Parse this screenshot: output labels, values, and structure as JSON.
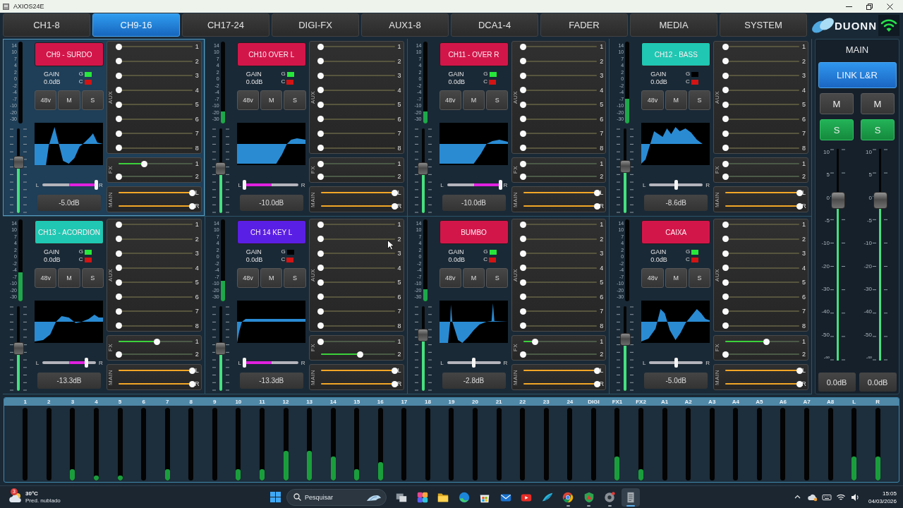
{
  "window": {
    "title": "AXIOS24E"
  },
  "tabs": [
    {
      "label": "CH1-8",
      "selected": false
    },
    {
      "label": "CH9-16",
      "selected": true
    },
    {
      "label": "CH17-24",
      "selected": false
    },
    {
      "label": "DIGI-FX",
      "selected": false
    },
    {
      "label": "AUX1-8",
      "selected": false
    },
    {
      "label": "DCA1-4",
      "selected": false
    },
    {
      "label": "FADER",
      "selected": false
    },
    {
      "label": "MEDIA",
      "selected": false
    },
    {
      "label": "SYSTEM",
      "selected": false
    }
  ],
  "logo": {
    "text": "DUONN"
  },
  "channels": [
    {
      "name": "CH9 - SURDO",
      "color": "#d3164a",
      "selected": true,
      "meter_scale": [
        "14",
        "10",
        "7",
        "4",
        "2",
        "0",
        "-2",
        "-4",
        "-7",
        "-10",
        "-20",
        "-30"
      ],
      "fader": {
        "level": 0.62
      },
      "gain": {
        "label": "GAIN",
        "value": "0.0dB"
      },
      "indicators": [
        {
          "label": "G",
          "color": "#27e83a",
          "on": true
        },
        {
          "label": "C",
          "color": "#d21414",
          "on": true
        }
      ],
      "buttons": [
        {
          "label": "48v",
          "on": false
        },
        {
          "label": "M",
          "on": false
        },
        {
          "label": "S",
          "on": false
        }
      ],
      "pan": {
        "left": "L",
        "right": "R",
        "level": 1
      },
      "fader_value": "-5.0dB",
      "aux": {
        "title": "AUX",
        "sends": [
          {
            "label": "1",
            "level": 0
          },
          {
            "label": "2",
            "level": 0
          },
          {
            "label": "3",
            "level": 0
          },
          {
            "label": "4",
            "level": 0
          },
          {
            "label": "5",
            "level": 0
          },
          {
            "label": "6",
            "level": 0
          },
          {
            "label": "7",
            "level": 0
          },
          {
            "label": "8",
            "level": 0
          }
        ]
      },
      "fx": {
        "title": "FX",
        "sends": [
          {
            "label": "1",
            "level": 0.35
          },
          {
            "label": "2",
            "level": 0
          }
        ]
      },
      "main": {
        "title": "MAIN",
        "sends": [
          {
            "label": "L",
            "level": 1
          },
          {
            "label": "R",
            "level": 1
          }
        ]
      }
    },
    {
      "name": "CH10 OVER L",
      "color": "#d3164a",
      "selected": false,
      "meter_scale": [
        "14",
        "10",
        "7",
        "4",
        "2",
        "0",
        "-2",
        "-4",
        "-7",
        "-10",
        "-20",
        "-30"
      ],
      "meter": {
        "level": 0.15
      },
      "fader": {
        "level": 0.53
      },
      "gain": {
        "label": "GAIN",
        "value": "0.0dB"
      },
      "indicators": [
        {
          "label": "G",
          "color": "#27e83a",
          "on": true
        },
        {
          "label": "C",
          "color": "#d21414",
          "on": true
        }
      ],
      "buttons": [
        {
          "label": "48v",
          "on": false
        },
        {
          "label": "M",
          "on": false
        },
        {
          "label": "S",
          "on": false
        }
      ],
      "pan": {
        "left": "L",
        "right": "R",
        "level": 0
      },
      "fader_value": "-10.0dB",
      "aux": {
        "title": "AUX",
        "sends": [
          {
            "label": "1",
            "level": 0
          },
          {
            "label": "2",
            "level": 0
          },
          {
            "label": "3",
            "level": 0
          },
          {
            "label": "4",
            "level": 0
          },
          {
            "label": "5",
            "level": 0
          },
          {
            "label": "6",
            "level": 0
          },
          {
            "label": "7",
            "level": 0
          },
          {
            "label": "8",
            "level": 0
          }
        ]
      },
      "fx": {
        "title": "FX",
        "sends": [
          {
            "label": "1",
            "level": 0
          },
          {
            "label": "2",
            "level": 0
          }
        ]
      },
      "main": {
        "title": "MAIN",
        "sends": [
          {
            "label": "L",
            "level": 1
          },
          {
            "label": "R",
            "level": 1
          }
        ]
      }
    },
    {
      "name": "CH11 - OVER R",
      "color": "#d3164a",
      "selected": false,
      "meter_scale": [
        "14",
        "10",
        "7",
        "4",
        "2",
        "0",
        "-2",
        "-4",
        "-7",
        "-10",
        "-20",
        "-30"
      ],
      "meter": {
        "level": 0.15
      },
      "fader": {
        "level": 0.53
      },
      "gain": {
        "label": "GAIN",
        "value": "0.0dB"
      },
      "indicators": [
        {
          "label": "G",
          "color": "#27e83a",
          "on": true
        },
        {
          "label": "C",
          "color": "#d21414",
          "on": true
        }
      ],
      "buttons": [
        {
          "label": "48v",
          "on": false
        },
        {
          "label": "M",
          "on": false
        },
        {
          "label": "S",
          "on": false
        }
      ],
      "pan": {
        "left": "L",
        "right": "R",
        "level": 1
      },
      "fader_value": "-10.0dB",
      "aux": {
        "title": "AUX",
        "sends": [
          {
            "label": "1",
            "level": 0
          },
          {
            "label": "2",
            "level": 0
          },
          {
            "label": "3",
            "level": 0
          },
          {
            "label": "4",
            "level": 0
          },
          {
            "label": "5",
            "level": 0
          },
          {
            "label": "6",
            "level": 0
          },
          {
            "label": "7",
            "level": 0
          },
          {
            "label": "8",
            "level": 0
          }
        ]
      },
      "fx": {
        "title": "FX",
        "sends": [
          {
            "label": "1",
            "level": 0
          },
          {
            "label": "2",
            "level": 0
          }
        ]
      },
      "main": {
        "title": "MAIN",
        "sends": [
          {
            "label": "L",
            "level": 1
          },
          {
            "label": "R",
            "level": 1
          }
        ]
      }
    },
    {
      "name": "CH12 - BASS",
      "color": "#20c7b2",
      "selected": false,
      "meter_scale": [
        "14",
        "10",
        "7",
        "4",
        "2",
        "0",
        "-2",
        "-4",
        "-7",
        "-10",
        "-20",
        "-30"
      ],
      "meter": {
        "level": 0.3
      },
      "fader": {
        "level": 0.56
      },
      "gain": {
        "label": "GAIN",
        "value": "0.0dB"
      },
      "indicators": [
        {
          "label": "G",
          "on": false
        },
        {
          "label": "C",
          "color": "#d21414",
          "on": true
        }
      ],
      "buttons": [
        {
          "label": "48v",
          "on": false
        },
        {
          "label": "M",
          "on": false
        },
        {
          "label": "S",
          "on": false
        }
      ],
      "pan": {
        "left": "L",
        "right": "R",
        "level": 0.5
      },
      "fader_value": "-8.6dB",
      "aux": {
        "title": "AUX",
        "sends": [
          {
            "label": "1",
            "level": 0
          },
          {
            "label": "2",
            "level": 0
          },
          {
            "label": "3",
            "level": 0
          },
          {
            "label": "4",
            "level": 0
          },
          {
            "label": "5",
            "level": 0
          },
          {
            "label": "6",
            "level": 0
          },
          {
            "label": "7",
            "level": 0
          },
          {
            "label": "8",
            "level": 0
          }
        ]
      },
      "fx": {
        "title": "FX",
        "sends": [
          {
            "label": "1",
            "level": 0
          },
          {
            "label": "2",
            "level": 0
          }
        ]
      },
      "main": {
        "title": "MAIN",
        "sends": [
          {
            "label": "L",
            "level": 1
          },
          {
            "label": "R",
            "level": 1
          }
        ]
      }
    },
    {
      "name": "CH13 - ACORDION",
      "color": "#20c7b2",
      "selected": false,
      "meter_scale": [
        "14",
        "10",
        "7",
        "4",
        "2",
        "0",
        "-2",
        "-4",
        "-7",
        "-10",
        "-20",
        "-30"
      ],
      "meter": {
        "level": 0.35
      },
      "fader": {
        "level": 0.5
      },
      "gain": {
        "label": "GAIN",
        "value": "0.0dB"
      },
      "indicators": [
        {
          "label": "G",
          "color": "#27e83a",
          "on": true
        },
        {
          "label": "C",
          "color": "#d21414",
          "on": true
        }
      ],
      "buttons": [
        {
          "label": "48v",
          "on": false
        },
        {
          "label": "M",
          "on": false
        },
        {
          "label": "S",
          "on": false
        }
      ],
      "pan": {
        "left": "L",
        "right": "R",
        "level": 0.82
      },
      "fader_value": "-13.3dB",
      "aux": {
        "title": "AUX",
        "sends": [
          {
            "label": "1",
            "level": 0
          },
          {
            "label": "2",
            "level": 0
          },
          {
            "label": "3",
            "level": 0
          },
          {
            "label": "4",
            "level": 0
          },
          {
            "label": "5",
            "level": 0
          },
          {
            "label": "6",
            "level": 0
          },
          {
            "label": "7",
            "level": 0
          },
          {
            "label": "8",
            "level": 0
          }
        ]
      },
      "fx": {
        "title": "FX",
        "sends": [
          {
            "label": "1",
            "level": 0.52
          },
          {
            "label": "2",
            "level": 0
          }
        ]
      },
      "main": {
        "title": "MAIN",
        "sends": [
          {
            "label": "L",
            "level": 1
          },
          {
            "label": "R",
            "level": 1
          }
        ]
      }
    },
    {
      "name": "CH 14 KEY L",
      "color": "#5a1fe4",
      "selected": false,
      "meter_scale": [
        "14",
        "10",
        "7",
        "4",
        "2",
        "0",
        "-2",
        "-4",
        "-7",
        "-10",
        "-20",
        "-30"
      ],
      "meter": {
        "level": 0.25
      },
      "fader": {
        "level": 0.5
      },
      "gain": {
        "label": "GAIN",
        "value": "0.0dB"
      },
      "indicators": [
        {
          "label": "G",
          "on": false
        },
        {
          "label": "C",
          "color": "#d21414",
          "on": true
        }
      ],
      "buttons": [
        {
          "label": "48v",
          "on": false
        },
        {
          "label": "M",
          "on": false
        },
        {
          "label": "S",
          "on": false
        }
      ],
      "pan": {
        "left": "L",
        "right": "R",
        "level": 0
      },
      "fader_value": "-13.3dB",
      "aux": {
        "title": "AUX",
        "sends": [
          {
            "label": "1",
            "level": 0
          },
          {
            "label": "2",
            "level": 0
          },
          {
            "label": "3",
            "level": 0
          },
          {
            "label": "4",
            "level": 0
          },
          {
            "label": "5",
            "level": 0
          },
          {
            "label": "6",
            "level": 0
          },
          {
            "label": "7",
            "level": 0
          },
          {
            "label": "8",
            "level": 0
          }
        ]
      },
      "fx": {
        "title": "FX",
        "sends": [
          {
            "label": "1",
            "level": 0
          },
          {
            "label": "2",
            "level": 0.53
          }
        ]
      },
      "main": {
        "title": "MAIN",
        "sends": [
          {
            "label": "L",
            "level": 1
          },
          {
            "label": "R",
            "level": 1
          }
        ]
      }
    },
    {
      "name": "BUMBO",
      "color": "#d3164a",
      "selected": false,
      "meter_scale": [
        "14",
        "10",
        "7",
        "4",
        "2",
        "0",
        "-2",
        "-4",
        "-7",
        "-10",
        "-20",
        "-30"
      ],
      "meter": {
        "level": 0.15
      },
      "fader": {
        "level": 0.69
      },
      "gain": {
        "label": "GAIN",
        "value": "0.0dB"
      },
      "indicators": [
        {
          "label": "G",
          "color": "#27e83a",
          "on": true
        },
        {
          "label": "C",
          "color": "#d21414",
          "on": true
        }
      ],
      "buttons": [
        {
          "label": "48v",
          "on": false
        },
        {
          "label": "M",
          "on": false
        },
        {
          "label": "S",
          "on": false
        }
      ],
      "pan": {
        "left": "L",
        "right": "R",
        "level": 0.5
      },
      "fader_value": "-2.8dB",
      "aux": {
        "title": "AUX",
        "sends": [
          {
            "label": "1",
            "level": 0
          },
          {
            "label": "2",
            "level": 0
          },
          {
            "label": "3",
            "level": 0
          },
          {
            "label": "4",
            "level": 0
          },
          {
            "label": "5",
            "level": 0
          },
          {
            "label": "6",
            "level": 0
          },
          {
            "label": "7",
            "level": 0
          },
          {
            "label": "8",
            "level": 0
          }
        ]
      },
      "fx": {
        "title": "FX",
        "sends": [
          {
            "label": "1",
            "level": 0.16
          },
          {
            "label": "2",
            "level": 0
          }
        ]
      },
      "main": {
        "title": "MAIN",
        "sends": [
          {
            "label": "L",
            "level": 1
          },
          {
            "label": "R",
            "level": 1
          }
        ]
      }
    },
    {
      "name": "CAIXA",
      "color": "#d3164a",
      "selected": false,
      "meter_scale": [
        "14",
        "10",
        "7",
        "4",
        "2",
        "0",
        "-2",
        "-4",
        "-7",
        "-10",
        "-20",
        "-30"
      ],
      "fader": {
        "level": 0.63
      },
      "gain": {
        "label": "GAIN",
        "value": "0.0dB"
      },
      "indicators": [
        {
          "label": "G",
          "color": "#27e83a",
          "on": true
        },
        {
          "label": "C",
          "color": "#d21414",
          "on": true
        }
      ],
      "buttons": [
        {
          "label": "48v",
          "on": false
        },
        {
          "label": "M",
          "on": false
        },
        {
          "label": "S",
          "on": false
        }
      ],
      "pan": {
        "left": "L",
        "right": "R",
        "level": 0.5
      },
      "fader_value": "-5.0dB",
      "aux": {
        "title": "AUX",
        "sends": [
          {
            "label": "1",
            "level": 0
          },
          {
            "label": "2",
            "level": 0
          },
          {
            "label": "3",
            "level": 0
          },
          {
            "label": "4",
            "level": 0
          },
          {
            "label": "5",
            "level": 0
          },
          {
            "label": "6",
            "level": 0
          },
          {
            "label": "7",
            "level": 0
          },
          {
            "label": "8",
            "level": 0
          }
        ]
      },
      "fx": {
        "title": "FX",
        "sends": [
          {
            "label": "1",
            "level": 0.56
          },
          {
            "label": "2",
            "level": 0
          }
        ]
      },
      "main": {
        "title": "MAIN",
        "sends": [
          {
            "label": "L",
            "level": 1
          },
          {
            "label": "R",
            "level": 1
          }
        ]
      }
    }
  ],
  "master": {
    "title": "MAIN",
    "link": {
      "label": "LINK L&R",
      "on": true
    },
    "outputs": [
      {
        "mute": {
          "label": "M",
          "on": false
        },
        "solo": {
          "label": "S",
          "on": true
        },
        "scale": [
          "10",
          "5",
          "0",
          "-5",
          "-10",
          "-20",
          "-30",
          "-40",
          "-50",
          "-∞"
        ],
        "fader": {
          "level": 0.78
        },
        "value": "0.0dB"
      },
      {
        "mute": {
          "label": "M",
          "on": false
        },
        "solo": {
          "label": "S",
          "on": true
        },
        "scale": [
          "10",
          "5",
          "0",
          "-5",
          "-10",
          "-20",
          "-30",
          "-40",
          "-50",
          "-∞"
        ],
        "fader": {
          "level": 0.78
        },
        "value": "0.0dB"
      }
    ]
  },
  "bus_meters": [
    {
      "label": "1"
    },
    {
      "label": "2"
    },
    {
      "label": "3",
      "level": 0.16
    },
    {
      "label": "4",
      "level": 0.07
    },
    {
      "label": "5",
      "level": 0.07
    },
    {
      "label": "6"
    },
    {
      "label": "7",
      "level": 0.16
    },
    {
      "label": "8"
    },
    {
      "label": "9"
    },
    {
      "label": "10",
      "level": 0.16
    },
    {
      "label": "11",
      "level": 0.16
    },
    {
      "label": "12",
      "level": 0.41
    },
    {
      "label": "13",
      "level": 0.41
    },
    {
      "label": "14",
      "level": 0.33
    },
    {
      "label": "15",
      "level": 0.16
    },
    {
      "label": "16",
      "level": 0.25
    },
    {
      "label": "17"
    },
    {
      "label": "18"
    },
    {
      "label": "19"
    },
    {
      "label": "20"
    },
    {
      "label": "21"
    },
    {
      "label": "22"
    },
    {
      "label": "23"
    },
    {
      "label": "24"
    },
    {
      "label": "DIGI"
    },
    {
      "label": "FX1",
      "level": 0.33
    },
    {
      "label": "FX2",
      "level": 0.16
    },
    {
      "label": "A1"
    },
    {
      "label": "A2"
    },
    {
      "label": "A3"
    },
    {
      "label": "A4"
    },
    {
      "label": "A5"
    },
    {
      "label": "A6"
    },
    {
      "label": "A7"
    },
    {
      "label": "A8"
    },
    {
      "label": "L",
      "level": 0.33
    },
    {
      "label": "R",
      "level": 0.33
    }
  ],
  "taskbar": {
    "weather": {
      "badge": "3",
      "temperature": "30°C",
      "forecast": "Pred. nublado"
    },
    "search": {
      "placeholder": "Pesquisar"
    },
    "apps": [
      {
        "kind": "taskview",
        "running": false,
        "selected": false
      },
      {
        "kind": "copilot",
        "running": false,
        "selected": false
      },
      {
        "kind": "folder",
        "running": false,
        "selected": false
      },
      {
        "kind": "edge",
        "running": false,
        "selected": false
      },
      {
        "kind": "store",
        "running": false,
        "selected": false
      },
      {
        "kind": "outlook",
        "running": false,
        "selected": false
      },
      {
        "kind": "youtube",
        "running": false,
        "selected": false
      },
      {
        "kind": "wing",
        "running": false,
        "selected": false
      },
      {
        "kind": "chrome",
        "running": true,
        "selected": false
      },
      {
        "kind": "shield",
        "running": true,
        "selected": false
      },
      {
        "kind": "disc",
        "running": true,
        "selected": false
      },
      {
        "kind": "mixer",
        "running": true,
        "selected": true
      }
    ],
    "clock": {
      "time": "15:05",
      "date": "04/03/2026"
    }
  }
}
